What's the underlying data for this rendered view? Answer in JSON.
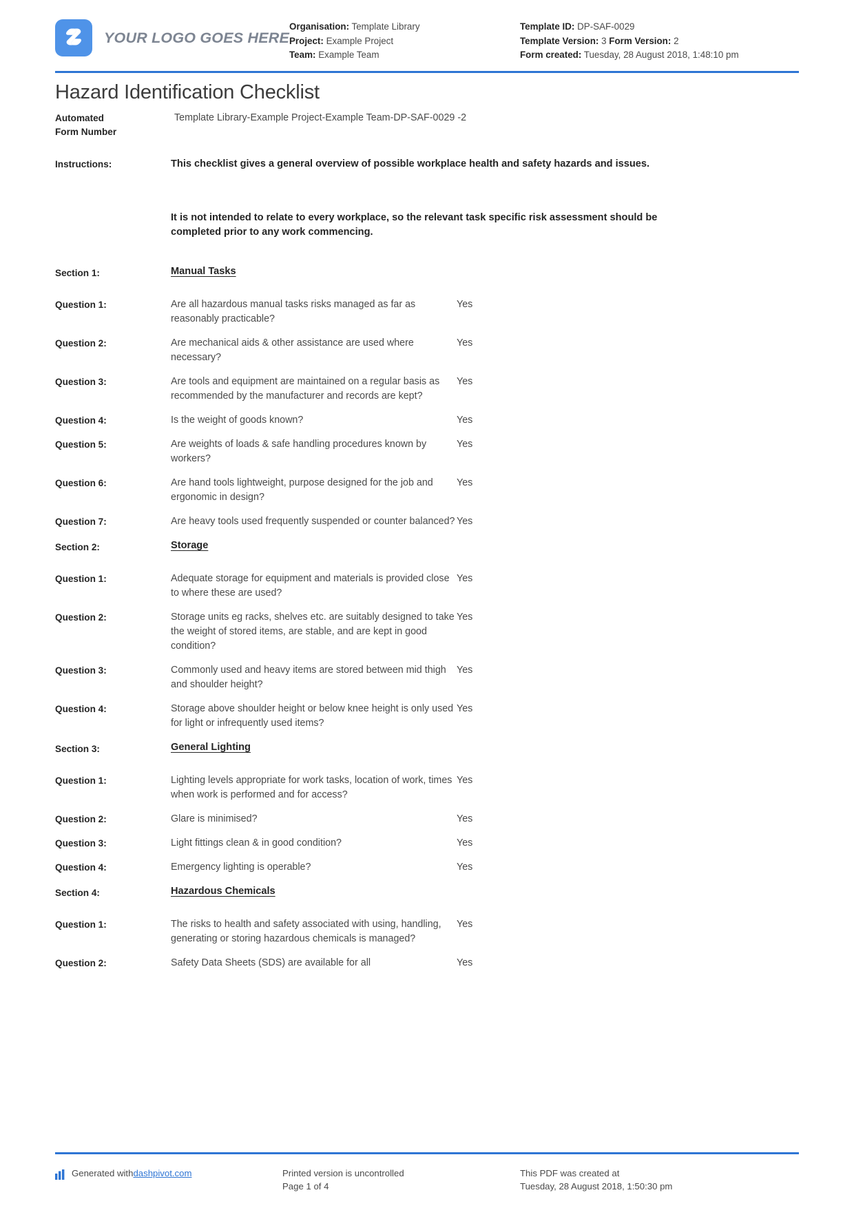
{
  "header": {
    "logo_text": "YOUR LOGO GOES HERE",
    "logo_icon": "dashpivot-s-logo-icon",
    "accent_color": "#2e75d4",
    "meta_left": [
      {
        "label": "Organisation:",
        "value": "Template Library"
      },
      {
        "label": "Project:",
        "value": "Example Project"
      },
      {
        "label": "Team:",
        "value": "Example Team"
      }
    ],
    "meta_right": [
      {
        "label": "Template ID:",
        "value": "DP-SAF-0029"
      },
      {
        "label": "Template Version:",
        "value": "3",
        "label2": "Form Version:",
        "value2": "2"
      },
      {
        "label": "Form created:",
        "value": "Tuesday, 28 August 2018, 1:48:10 pm"
      }
    ]
  },
  "document": {
    "title": "Hazard Identification Checklist",
    "automated_form_number_label_line1": "Automated",
    "automated_form_number_label_line2": "Form Number",
    "automated_form_number_value": "Template Library-Example Project-Example Team-DP-SAF-0029   -2",
    "instructions_label": "Instructions:",
    "instructions_paragraph_1": "This checklist gives a general overview of possible workplace health and safety hazards and issues.",
    "instructions_paragraph_2": "It is not intended to relate to every workplace, so the relevant task specific risk assessment should be completed prior to any work commencing."
  },
  "sections": [
    {
      "label": "Section 1:",
      "name": "Manual Tasks",
      "questions": [
        {
          "label": "Question 1:",
          "text": "Are all hazardous manual tasks risks managed as far as reasonably practicable?",
          "answer": "Yes"
        },
        {
          "label": "Question 2:",
          "text": "Are mechanical aids & other assistance are used where necessary?",
          "answer": "Yes"
        },
        {
          "label": "Question 3:",
          "text": "Are tools and equipment are maintained on a regular basis as recommended by the manufacturer and records are kept?",
          "answer": "Yes"
        },
        {
          "label": "Question 4:",
          "text": "Is the weight of goods known?",
          "answer": "Yes"
        },
        {
          "label": "Question 5:",
          "text": "Are weights of loads & safe handling procedures known by workers?",
          "answer": "Yes"
        },
        {
          "label": "Question 6:",
          "text": "Are hand tools lightweight, purpose designed for the job and ergonomic in design?",
          "answer": "Yes"
        },
        {
          "label": "Question 7:",
          "text": "Are heavy tools used frequently suspended or counter balanced?",
          "answer": "Yes"
        }
      ]
    },
    {
      "label": "Section 2:",
      "name": "Storage",
      "questions": [
        {
          "label": "Question 1:",
          "text": "Adequate storage for equipment and materials is provided close to where these are used?",
          "answer": "Yes"
        },
        {
          "label": "Question 2:",
          "text": "Storage units eg racks, shelves etc. are suitably designed to take the weight of stored items, are stable, and are kept in good condition?",
          "answer": "Yes"
        },
        {
          "label": "Question 3:",
          "text": "Commonly used and heavy items are stored between mid thigh and shoulder height?",
          "answer": "Yes"
        },
        {
          "label": "Question 4:",
          "text": "Storage above shoulder height or below knee height is only used for light or infrequently used items?",
          "answer": "Yes"
        }
      ]
    },
    {
      "label": "Section 3:",
      "name": "General Lighting",
      "questions": [
        {
          "label": "Question 1:",
          "text": "Lighting levels appropriate for work tasks, location of work, times when work is performed and for access?",
          "answer": "Yes"
        },
        {
          "label": "Question 2:",
          "text": "Glare is minimised?",
          "answer": "Yes"
        },
        {
          "label": "Question 3:",
          "text": "Light fittings clean & in good condition?",
          "answer": "Yes"
        },
        {
          "label": "Question 4:",
          "text": "Emergency lighting is operable?",
          "answer": "Yes"
        }
      ]
    },
    {
      "label": "Section 4:",
      "name": "Hazardous Chemicals",
      "questions": [
        {
          "label": "Question 1:",
          "text": "The risks to health and safety associated with using, handling, generating or storing hazardous chemicals is managed?",
          "answer": "Yes"
        },
        {
          "label": "Question 2:",
          "text": "Safety Data Sheets (SDS) are available for all",
          "answer": "Yes"
        }
      ]
    }
  ],
  "footer": {
    "generated_prefix": "Generated with ",
    "generated_link": "dashpivot.com",
    "bars_icon": "bar-chart-icon",
    "printed_line_1": "Printed version is uncontrolled",
    "printed_line_2": "Page 1 of 4",
    "created_line_1": "This PDF was created at",
    "created_line_2": "Tuesday, 28 August 2018, 1:50:30 pm"
  }
}
